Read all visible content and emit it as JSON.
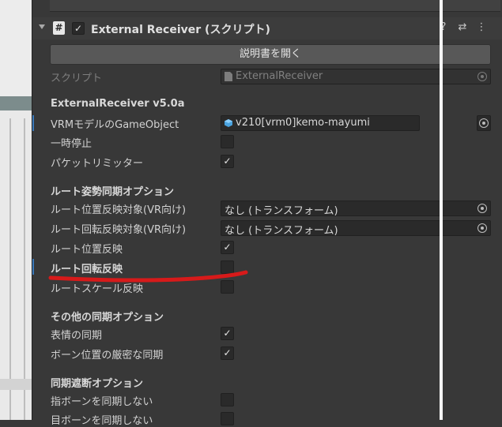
{
  "header": {
    "title": "External Receiver (スクリプト)",
    "enabled_check": "✓",
    "help_icon": "?",
    "presets_icon": "⇄",
    "menu_icon": "⋮"
  },
  "open_manual_button": "説明書を開く",
  "script_row": {
    "label": "スクリプト",
    "value": "ExternalReceiver"
  },
  "sections": {
    "main_title": "ExternalReceiver v5.0a",
    "root_title": "ルート姿勢同期オプション",
    "other_title": "その他の同期オプション",
    "block_title": "同期遮断オプション"
  },
  "rows": {
    "vrm_label": "VRMモデルのGameObject",
    "vrm_value": "v210[vrm0]kemo-mayumi",
    "pause_label": "一時停止",
    "packet_limiter_label": "パケットリミッター",
    "root_pos_target_label": "ルート位置反映対象(VR向け)",
    "root_pos_target_value": "なし (トランスフォーム)",
    "root_rot_target_label": "ルート回転反映対象(VR向け)",
    "root_rot_target_value": "なし (トランスフォーム)",
    "root_pos_label": "ルート位置反映",
    "root_rot_label": "ルート回転反映",
    "root_scale_label": "ルートスケール反映",
    "expression_label": "表情の同期",
    "bone_pos_label": "ボーン位置の厳密な同期",
    "finger_bone_label": "指ボーンを同期しない",
    "eye_bone_label": "目ボーンを同期しない"
  },
  "checkmark": "✓"
}
